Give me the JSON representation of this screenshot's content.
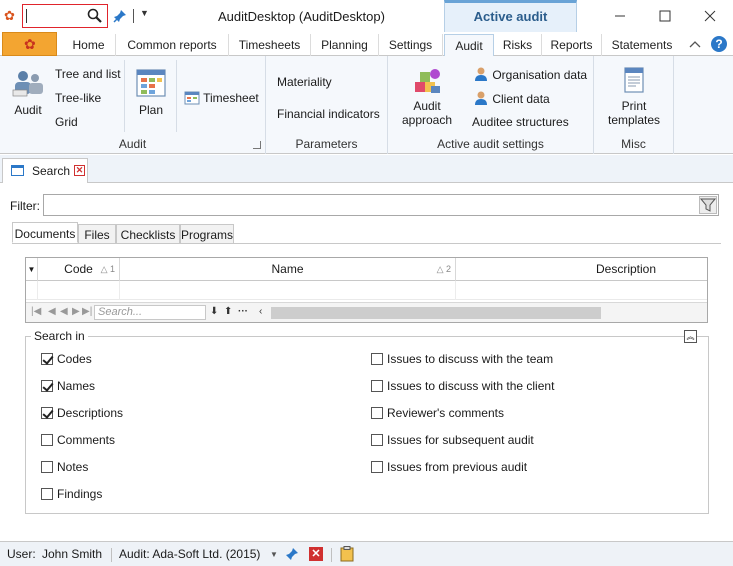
{
  "window": {
    "title": "AuditDesktop (AuditDesktop)",
    "context_tab_header": "Active audit"
  },
  "ribbon_tabs": [
    "Home",
    "Common reports",
    "Timesheets",
    "Planning",
    "Settings",
    "Audit",
    "Risks",
    "Reports",
    "Statements"
  ],
  "active_tab": "Audit",
  "ribbon": {
    "groups": {
      "audit": {
        "label": "Audit",
        "audit_button": "Audit",
        "tree_and_list": "Tree and list",
        "tree_like": "Tree-like",
        "grid": "Grid"
      },
      "plan": {
        "plan_button": "Plan",
        "timesheet_button": "Timesheet"
      },
      "parameters": {
        "label": "Parameters",
        "materiality": "Materiality",
        "financial_indicators": "Financial indicators"
      },
      "active_audit_settings": {
        "label": "Active audit settings",
        "audit_approach_line1": "Audit",
        "audit_approach_line2": "approach",
        "organisation_data": "Organisation data",
        "client_data": "Client data",
        "auditee_structures": "Auditee structures"
      },
      "misc": {
        "label": "Misc",
        "print_templates_line1": "Print",
        "print_templates_line2": "templates"
      }
    }
  },
  "document_tab": {
    "label": "Search"
  },
  "filter": {
    "label": "Filter:",
    "value": ""
  },
  "inner_tabs": [
    "Documents",
    "Files",
    "Checklists",
    "Programs"
  ],
  "grid": {
    "columns": [
      {
        "label": "Code",
        "sort": "1"
      },
      {
        "label": "Name",
        "sort": "2"
      },
      {
        "label": "Description",
        "sort": ""
      }
    ],
    "search_placeholder": "Search..."
  },
  "search_in": {
    "label": "Search in",
    "left": [
      {
        "label": "Codes",
        "checked": true
      },
      {
        "label": "Names",
        "checked": true
      },
      {
        "label": "Descriptions",
        "checked": true
      },
      {
        "label": "Comments",
        "checked": false
      },
      {
        "label": "Notes",
        "checked": false
      },
      {
        "label": "Findings",
        "checked": false
      }
    ],
    "right": [
      {
        "label": "Issues to discuss with the team",
        "checked": false
      },
      {
        "label": "Issues to discuss with the client",
        "checked": false
      },
      {
        "label": "Reviewer's comments",
        "checked": false
      },
      {
        "label": "Issues for subsequent audit",
        "checked": false
      },
      {
        "label": "Issues from previous audit",
        "checked": false
      }
    ]
  },
  "status_bar": {
    "user_label": "User:",
    "user_name": "John  Smith",
    "audit_label": "Audit: Ada-Soft Ltd. (2015)"
  },
  "icons": {
    "app": "app-logo-icon",
    "search": "magnifier-icon",
    "pin": "pin-icon",
    "help": "help-icon"
  },
  "colors": {
    "accent": "#2b78c8",
    "file_button": "#f3a531",
    "search_highlight": "#e0242c",
    "close_red": "#d03030"
  }
}
